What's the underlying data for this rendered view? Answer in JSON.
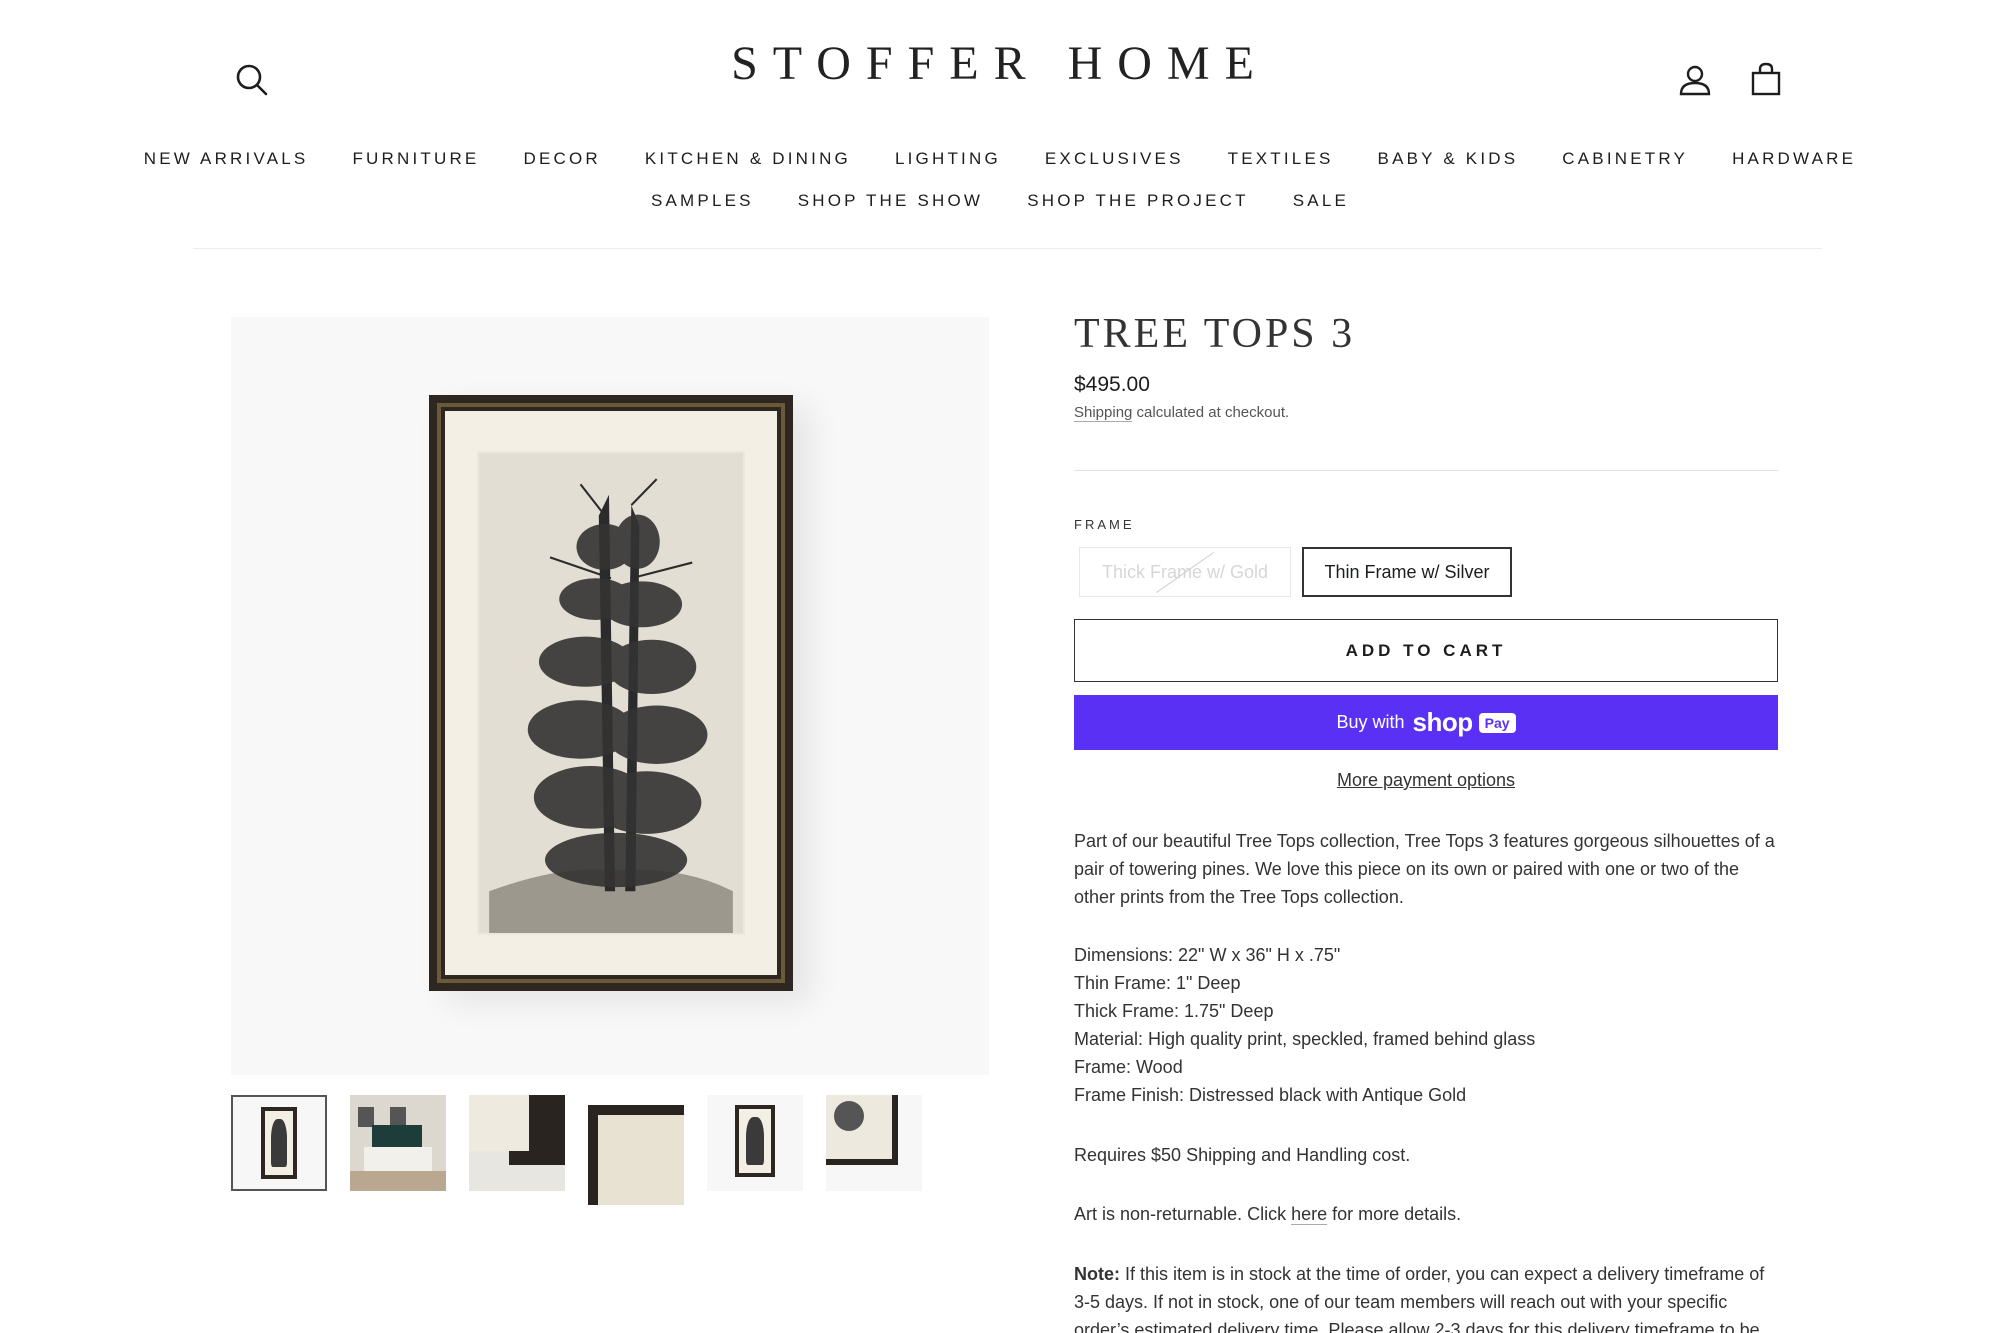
{
  "header": {
    "logo": "STOFFER HOME",
    "nav_row1": [
      "NEW ARRIVALS",
      "FURNITURE",
      "DECOR",
      "KITCHEN & DINING",
      "LIGHTING",
      "EXCLUSIVES",
      "TEXTILES",
      "BABY & KIDS",
      "CABINETRY",
      "HARDWARE"
    ],
    "nav_row2": [
      "SAMPLES",
      "SHOP THE SHOW",
      "SHOP THE PROJECT",
      "SALE"
    ],
    "icons": {
      "search": "search-icon",
      "account": "account-icon",
      "cart": "cart-icon"
    }
  },
  "product": {
    "title": "TREE TOPS 3",
    "price": "$495.00",
    "shipping_link": "Shipping",
    "shipping_note": " calculated at checkout.",
    "option_label": "FRAME",
    "variants": [
      {
        "label": "Thick Frame w/ Gold",
        "state": "unavailable"
      },
      {
        "label": "Thin Frame w/ Silver",
        "state": "selected"
      }
    ],
    "add_to_cart": "ADD TO CART",
    "shop_pay": {
      "buy_with": "Buy with",
      "shop": "shop",
      "pay": "Pay",
      "color": "#5a31f4"
    },
    "more_payment": "More payment options",
    "description": {
      "intro": "Part of our beautiful Tree Tops collection, Tree Tops 3 features  gorgeous silhouettes of a pair of towering pines. We love this piece on its own or paired with one or two of the other prints from the Tree Tops collection.",
      "specs": [
        "Dimensions:  22\" W x 36\" H x .75\"",
        "Thin Frame: 1\" Deep",
        "Thick Frame: 1.75\" Deep",
        "Material: High quality print, speckled, framed behind glass",
        "Frame: Wood",
        "Frame Finish: Distressed black with Antique Gold"
      ],
      "shipping_req": "Requires $50 Shipping and Handling cost.",
      "returns_before": "Art is non-returnable. Click ",
      "returns_link": "here",
      "returns_after": " for more details.",
      "note_label": "Note:",
      "note_text": " If this item is in stock at the time of order, you can expect a delivery timeframe of 3-5 days. If not in stock, one of our team members will reach out with your specific order’s estimated delivery time. Please allow 2-3 days for this delivery timeframe to be"
    }
  },
  "gallery": {
    "thumbnail_count": 6,
    "active_thumbnail": 1
  }
}
